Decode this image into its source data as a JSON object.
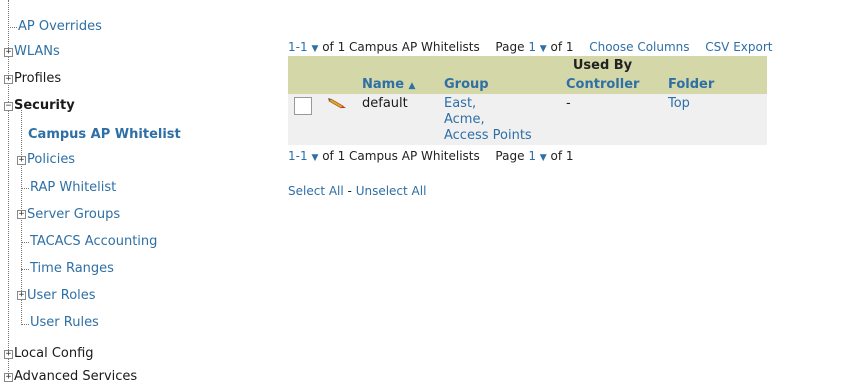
{
  "sidebar": {
    "items": [
      {
        "label": "AP Overrides"
      },
      {
        "label": "WLANs"
      },
      {
        "label": "Profiles"
      },
      {
        "label": "Security"
      },
      {
        "label": "Campus AP Whitelist"
      },
      {
        "label": "Policies"
      },
      {
        "label": "RAP Whitelist"
      },
      {
        "label": "Server Groups"
      },
      {
        "label": "TACACS Accounting"
      },
      {
        "label": "Time Ranges"
      },
      {
        "label": "User Roles"
      },
      {
        "label": "User Rules"
      },
      {
        "label": "Local Config"
      },
      {
        "label": "Advanced Services"
      }
    ],
    "toggle_expand": "+",
    "toggle_collapse": "−"
  },
  "pager_top": {
    "range": "1-1",
    "of_text": "of 1 Campus AP Whitelists",
    "page_label": "Page",
    "page_value": "1",
    "page_of": "of 1",
    "choose_columns": "Choose Columns",
    "csv_export": "CSV Export"
  },
  "table": {
    "group_header": "Used By",
    "columns": {
      "name": "Name",
      "sort_indicator": "▲",
      "group": "Group",
      "controller": "Controller",
      "folder": "Folder"
    },
    "rows": [
      {
        "name": "default",
        "groups": [
          "East,",
          "Acme,",
          "Access Points"
        ],
        "controller": "-",
        "folder": "Top"
      }
    ]
  },
  "pager_bottom": {
    "range": "1-1",
    "of_text": "of 1 Campus AP Whitelists",
    "page_label": "Page",
    "page_value": "1",
    "page_of": "of 1"
  },
  "selection": {
    "select_all": "Select All",
    "separator": " - ",
    "unselect_all": "Unselect All"
  },
  "icons": {
    "caret": "▼",
    "edit": "pencil-icon"
  }
}
